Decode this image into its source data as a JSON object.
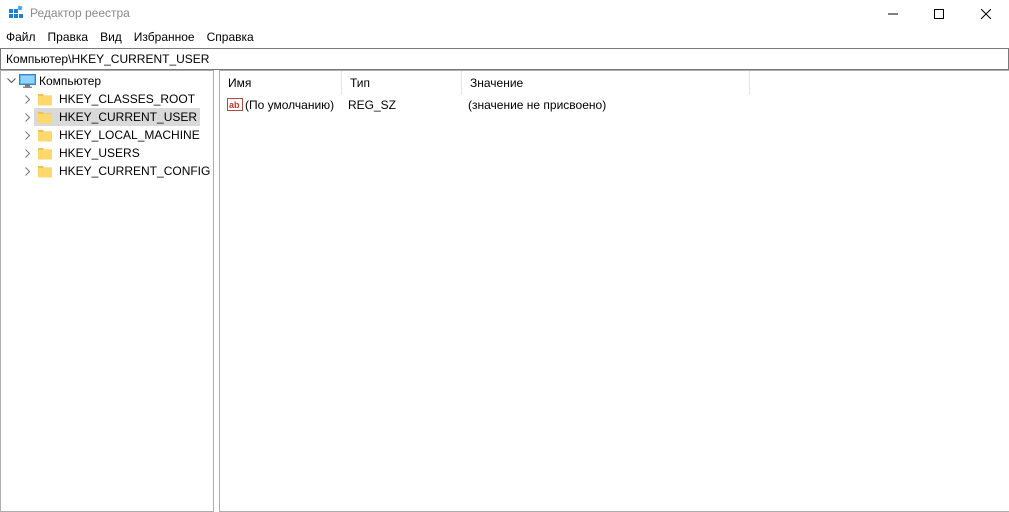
{
  "window": {
    "title": "Редактор реестра"
  },
  "menu": {
    "items": [
      "Файл",
      "Правка",
      "Вид",
      "Избранное",
      "Справка"
    ]
  },
  "address": {
    "path": "Компьютер\\HKEY_CURRENT_USER"
  },
  "tree": {
    "root": "Компьютер",
    "items": [
      {
        "label": "HKEY_CLASSES_ROOT",
        "selected": false
      },
      {
        "label": "HKEY_CURRENT_USER",
        "selected": true
      },
      {
        "label": "HKEY_LOCAL_MACHINE",
        "selected": false
      },
      {
        "label": "HKEY_USERS",
        "selected": false
      },
      {
        "label": "HKEY_CURRENT_CONFIG",
        "selected": false
      }
    ]
  },
  "list": {
    "columns": [
      "Имя",
      "Тип",
      "Значение"
    ],
    "rows": [
      {
        "name": "(По умолчанию)",
        "type": "REG_SZ",
        "value": "(значение не присвоено)"
      }
    ]
  },
  "icons": {
    "app": "registry-editor-icon",
    "root": "computer-icon",
    "key": "folder-icon",
    "value": "string-value-icon"
  },
  "colors": {
    "selection": "#d9d9d9",
    "folder": "#ffd86b",
    "border": "#adadad"
  }
}
